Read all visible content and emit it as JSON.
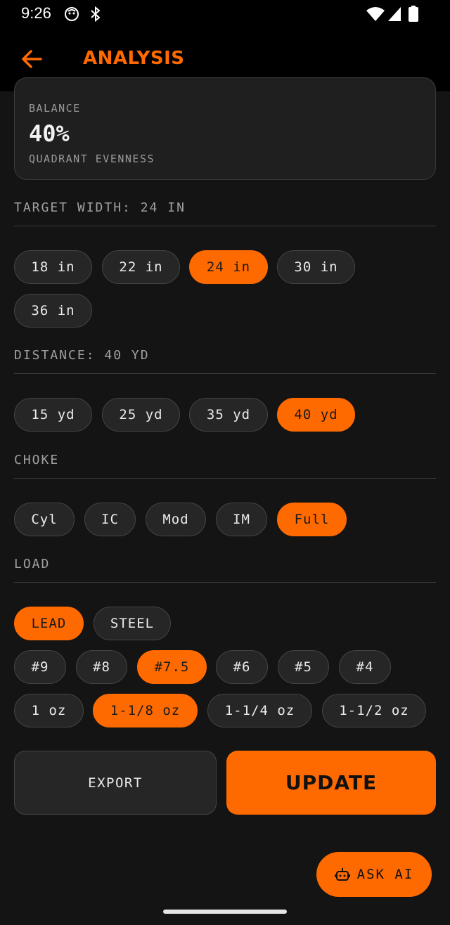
{
  "status": {
    "time": "9:26"
  },
  "appbar": {
    "title": "ANALYSIS"
  },
  "balance": {
    "label": "BALANCE",
    "value": "40%",
    "sub": "QUADRANT EVENNESS"
  },
  "target_width": {
    "heading": "TARGET WIDTH: 24 IN",
    "options": [
      "18 in",
      "22 in",
      "24 in",
      "30 in",
      "36 in"
    ],
    "selected": "24 in"
  },
  "distance": {
    "heading": "DISTANCE: 40 YD",
    "options": [
      "15 yd",
      "25 yd",
      "35 yd",
      "40 yd"
    ],
    "selected": "40 yd"
  },
  "choke": {
    "heading": "CHOKE",
    "options": [
      "Cyl",
      "IC",
      "Mod",
      "IM",
      "Full"
    ],
    "selected": "Full"
  },
  "load": {
    "heading": "LOAD",
    "material": {
      "options": [
        "LEAD",
        "STEEL"
      ],
      "selected": "LEAD"
    },
    "shot_size": {
      "options": [
        "#9",
        "#8",
        "#7.5",
        "#6",
        "#5",
        "#4"
      ],
      "selected": "#7.5"
    },
    "weight": {
      "options": [
        "1 oz",
        "1-1/8 oz",
        "1-1/4 oz",
        "1-1/2 oz"
      ],
      "selected": "1-1/8 oz"
    }
  },
  "actions": {
    "export": "EXPORT",
    "update": "UPDATE",
    "ask_ai": "ASK AI"
  },
  "colors": {
    "accent": "#ff6a00",
    "background": "#141414",
    "chip": "#262626"
  },
  "icons": [
    "back-arrow-icon",
    "robot-icon",
    "wifi-icon",
    "signal-icon",
    "battery-icon",
    "bluetooth-icon"
  ]
}
